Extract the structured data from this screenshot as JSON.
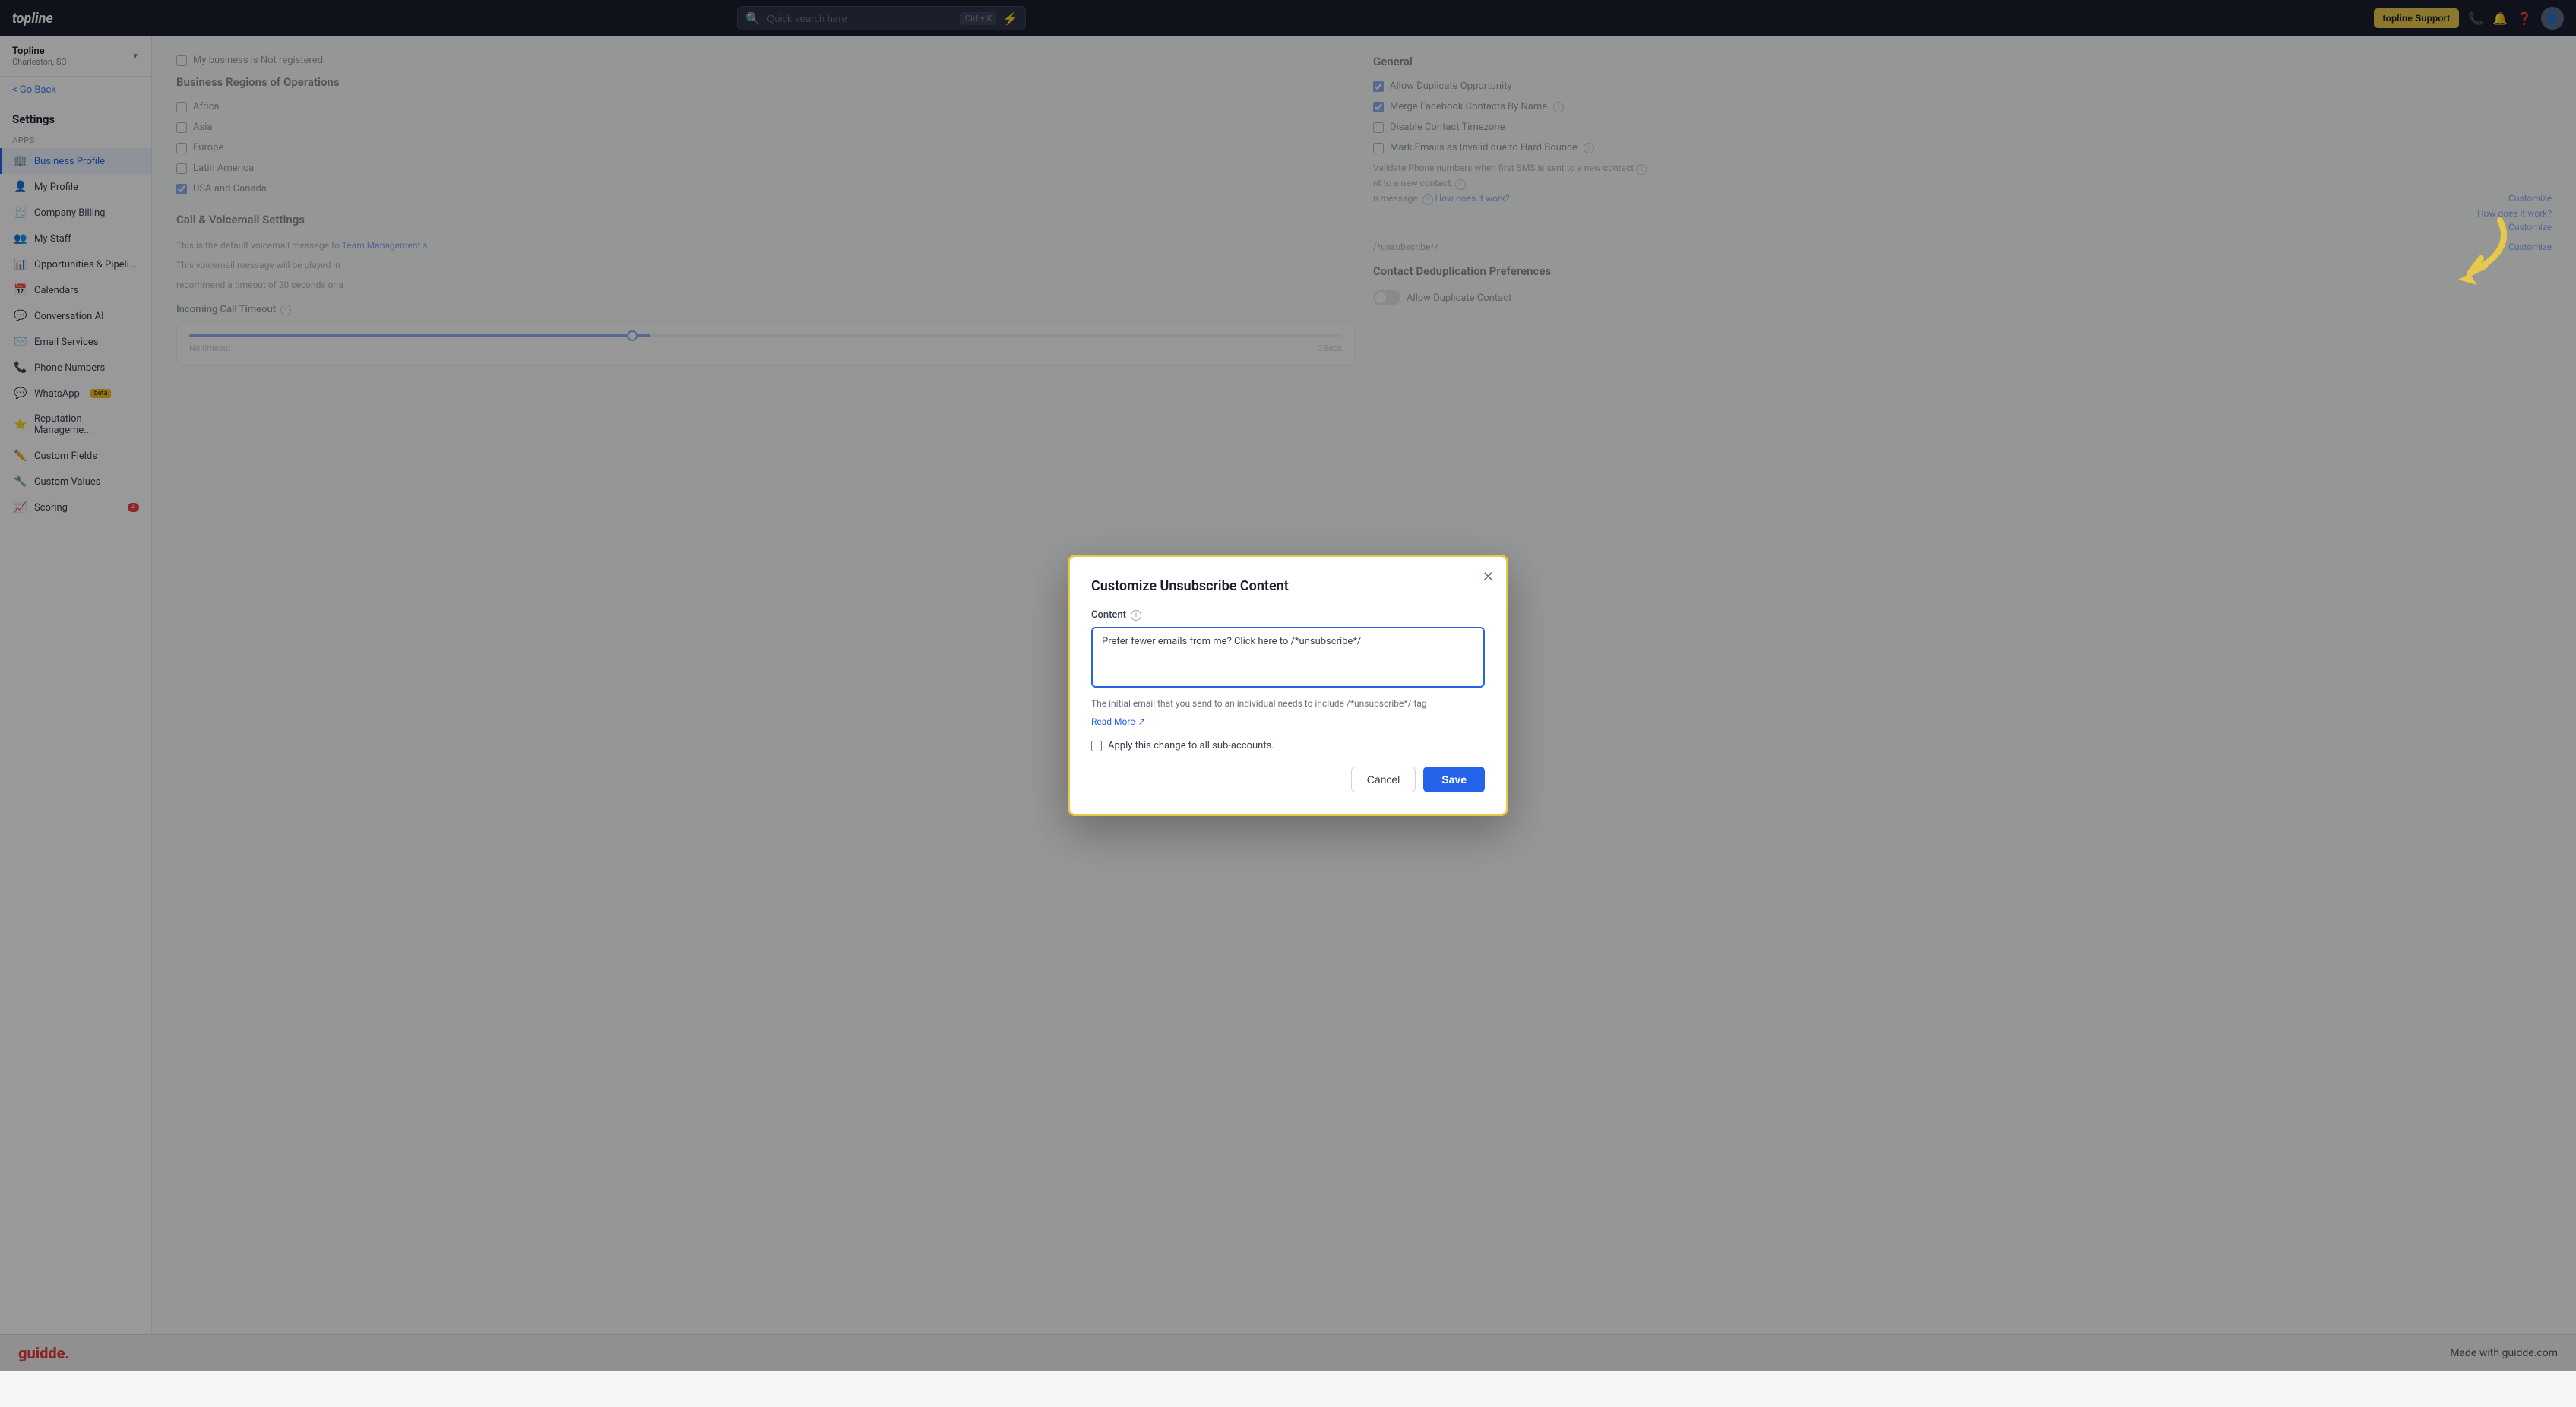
{
  "app": {
    "logo": "topline",
    "search_placeholder": "Quick search here",
    "search_shortcut": "Ctrl + K",
    "support_button": "topline Support"
  },
  "sidebar": {
    "workspace": {
      "name": "Topline",
      "location": "Charleston, SC"
    },
    "go_back": "< Go Back",
    "heading": "Settings",
    "section_label": "Apps",
    "items": [
      {
        "id": "business-profile",
        "icon": "🏢",
        "label": "Business Profile",
        "active": true
      },
      {
        "id": "my-profile",
        "icon": "👤",
        "label": "My Profile"
      },
      {
        "id": "company-billing",
        "icon": "🧾",
        "label": "Company Billing"
      },
      {
        "id": "my-staff",
        "icon": "👥",
        "label": "My Staff"
      },
      {
        "id": "opportunities",
        "icon": "📊",
        "label": "Opportunities & Pipeli..."
      },
      {
        "id": "calendars",
        "icon": "📅",
        "label": "Calendars"
      },
      {
        "id": "conversation-ai",
        "icon": "💬",
        "label": "Conversation AI"
      },
      {
        "id": "email-services",
        "icon": "✉️",
        "label": "Email Services"
      },
      {
        "id": "phone-numbers",
        "icon": "📞",
        "label": "Phone Numbers"
      },
      {
        "id": "whatsapp",
        "icon": "💬",
        "label": "WhatsApp",
        "badge": "beta"
      },
      {
        "id": "reputation",
        "icon": "⭐",
        "label": "Reputation Manageme..."
      },
      {
        "id": "custom-fields",
        "icon": "✏️",
        "label": "Custom Fields"
      },
      {
        "id": "custom-values",
        "icon": "🔧",
        "label": "Custom Values"
      },
      {
        "id": "scoring",
        "icon": "📈",
        "label": "Scoring",
        "badge_count": "4"
      }
    ]
  },
  "main": {
    "business_regions": {
      "title": "Business Regions of Operations",
      "not_registered_label": "My business is Not registered",
      "regions": [
        {
          "label": "Africa",
          "checked": false
        },
        {
          "label": "Asia",
          "checked": false
        },
        {
          "label": "Europe",
          "checked": false
        },
        {
          "label": "Latin America",
          "checked": false
        },
        {
          "label": "USA and Canada",
          "checked": true
        }
      ]
    },
    "general": {
      "title": "General",
      "items": [
        {
          "label": "Allow Duplicate Opportunity",
          "checked": true
        },
        {
          "label": "Merge Facebook Contacts By Name",
          "checked": true,
          "has_info": true
        },
        {
          "label": "Disable Contact Timezone",
          "checked": false
        },
        {
          "label": "Mark Emails as Invalid due to Hard Bounce",
          "checked": false,
          "has_info": true
        }
      ],
      "customize_link": "Customize",
      "how_does_it_work": "How does it work?"
    },
    "call_settings": {
      "title": "Call & Voicemail Settings",
      "voicemail_text1": "This is the default voicemail message fo",
      "voicemail_link": "Team Management s",
      "voicemail_text2": "This voicemail message will be played in",
      "voicemail_text3": "recommend a timeout of 20 seconds or a",
      "incoming_call_label": "Incoming Call Timeout",
      "slider_no_timeout": "No timeout",
      "slider_10_secs": "10 Secs"
    },
    "contact_dedup": {
      "title": "Contact Deduplication Preferences",
      "allow_duplicate_contact": "Allow Duplicate Contact"
    }
  },
  "modal": {
    "title": "Customize Unsubscribe Content",
    "content_label": "Content",
    "textarea_value": "Prefer fewer emails from me? Click here to /*unsubscribe*/",
    "hint_text": "The initial email that you send to an individual needs to include /*unsubscribe*/ tag",
    "read_more": "Read More",
    "read_more_icon": "↗",
    "apply_checkbox_label": "Apply this change to all sub-accounts.",
    "cancel_button": "Cancel",
    "save_button": "Save"
  },
  "footer": {
    "logo": "guidde.",
    "text": "Made with guidde.com"
  }
}
